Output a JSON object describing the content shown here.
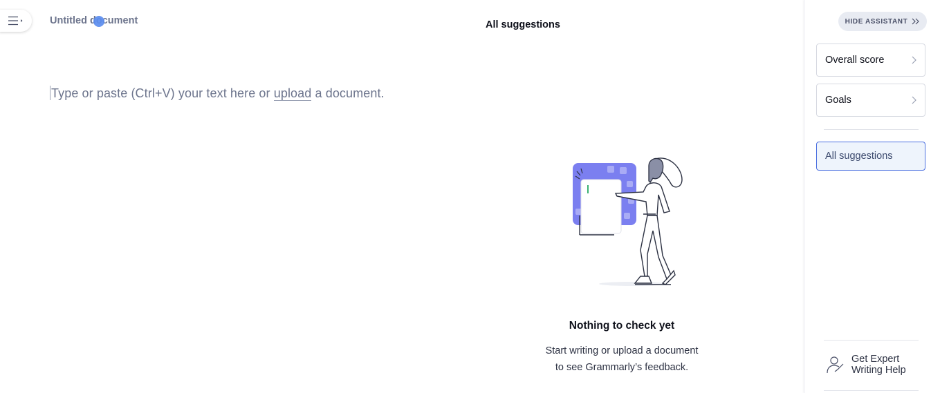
{
  "header": {
    "menu_icon": "hamburger-menu-icon",
    "doc_title": "Untitled document"
  },
  "editor": {
    "placeholder_before": "Type or paste (Ctrl+V) your text here or ",
    "upload_link": "upload",
    "placeholder_after": " a document."
  },
  "suggestions": {
    "heading": "All suggestions",
    "empty_title": "Nothing to check yet",
    "empty_line1": "Start writing or upload a document",
    "empty_line2": "to see Grammarly’s feedback."
  },
  "sidebar": {
    "hide_button": "HIDE ASSISTANT",
    "hide_icon": "double-chevron-right-icon",
    "overall_score": "Overall score",
    "goals": "Goals",
    "all_suggestions": "All suggestions",
    "expert_line1": "Get Expert",
    "expert_line2": "Writing Help",
    "expert_icon": "expert-person-icon"
  },
  "colors": {
    "accent": "#4a6ee0",
    "illustration_purple": "#7b7ff0",
    "cursor_dot": "#5b8def"
  }
}
